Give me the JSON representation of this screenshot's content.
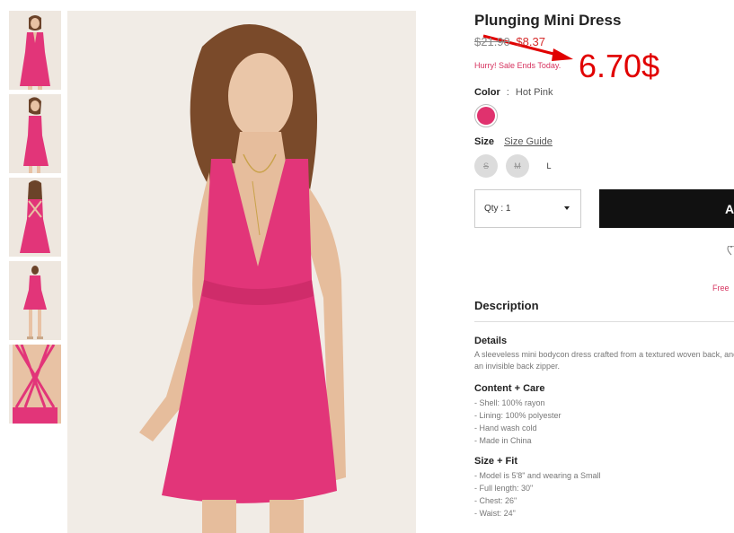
{
  "product": {
    "title": "Plunging Mini Dress",
    "price_old": "$21.90",
    "price_new": "$8.37",
    "sale_note": "Hurry! Sale Ends Today."
  },
  "annotation": {
    "price_text": "6.70$",
    "color": "#e10000"
  },
  "color": {
    "label": "Color",
    "separator": ":",
    "value": "Hot Pink",
    "swatch_hex": "#e0326e"
  },
  "size": {
    "label": "Size",
    "guide_label": "Size Guide",
    "options": [
      {
        "label": "S",
        "available": false
      },
      {
        "label": "M",
        "available": false
      },
      {
        "label": "L",
        "available": true
      }
    ]
  },
  "cart": {
    "qty_label": "Qty : 1",
    "add_label": "A"
  },
  "shipping": {
    "free_label": "Free"
  },
  "description": {
    "heading": "Description",
    "details_title": "Details",
    "details_text": "A sleeveless mini bodycon dress crafted from a textured woven back, and an invisible back zipper.",
    "content_title": "Content + Care",
    "content_lines": [
      "- Shell: 100% rayon",
      "- Lining: 100% polyester",
      "- Hand wash cold",
      "- Made in China"
    ],
    "fit_title": "Size + Fit",
    "fit_lines": [
      "- Model is 5'8\" and wearing a Small",
      "- Full length: 30\"",
      "- Chest: 26\"",
      "- Waist: 24\""
    ]
  },
  "icons": {
    "thumbnails": [
      "thumbnail-front-icon",
      "thumbnail-side-icon",
      "thumbnail-back-icon",
      "thumbnail-full-icon",
      "thumbnail-back-detail-icon"
    ],
    "wishlist": "heart-icon",
    "dropdown": "caret-down-icon"
  }
}
